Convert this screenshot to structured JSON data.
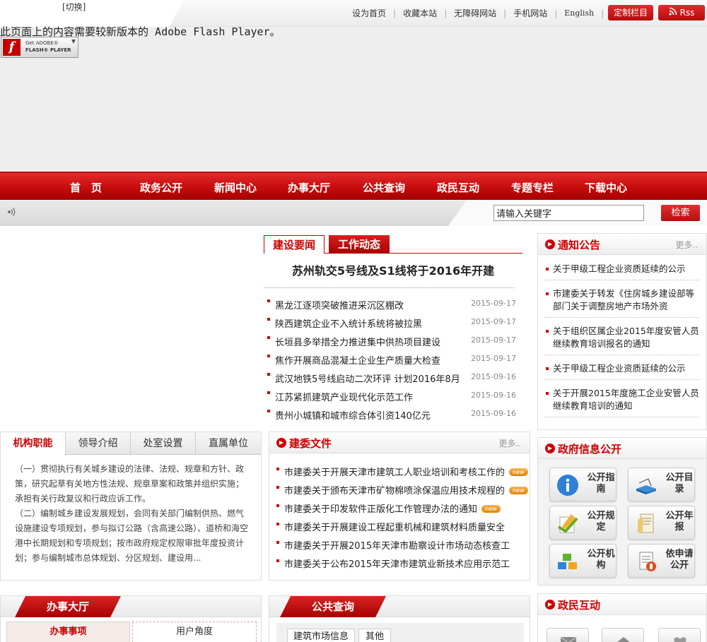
{
  "topbar": {
    "switch_label": "[切换]",
    "links": [
      "设为首页",
      "收藏本站",
      "无障碍网站",
      "手机网站",
      "English"
    ],
    "customize_label": "定制栏目",
    "rss_label": "Rss"
  },
  "flash": {
    "message": "此页面上的内容需要较新版本的 Adobe Flash Player。",
    "badge_line1": "Get ADOBE®",
    "badge_line2": "FLASH® PLAYER"
  },
  "nav": {
    "items": [
      "首　页",
      "政务公开",
      "新闻中心",
      "办事大厅",
      "公共查询",
      "政民互动",
      "专题专栏",
      "下载中心"
    ]
  },
  "search": {
    "value": "请输入关键字",
    "button_label": "检索"
  },
  "news": {
    "tabs": [
      "建设要闻",
      "工作动态"
    ],
    "headline": "苏州轨交5号线及S1线将于2016年开建",
    "items": [
      {
        "title": "黑龙江逐项突破推进采沉区棚改",
        "date": "2015-09-17"
      },
      {
        "title": "陕西建筑企业不入统计系统将被拉黑",
        "date": "2015-09-17"
      },
      {
        "title": "长垣县多举措全力推进集中供热项目建设",
        "date": "2015-09-17"
      },
      {
        "title": "焦作开展商品混凝土企业生产质量大检查",
        "date": "2015-09-17"
      },
      {
        "title": "武汉地铁5号线启动二次环评  计划2016年8月",
        "date": "2015-09-16"
      },
      {
        "title": "江苏紧抓建筑产业现代化示范工作",
        "date": "2015-09-16"
      },
      {
        "title": "贵州小城镇和城市综合体引资140亿元",
        "date": "2015-09-16"
      }
    ]
  },
  "notice": {
    "title": "通知公告",
    "more": "更多..",
    "items": [
      "关于甲级工程企业资质延续的公示",
      "市建委关于转发《住房城乡建设部等部门关于调整房地产市场外资",
      "关于组织区属企业2015年度安管人员继续教育培训报名的通知",
      "关于甲级工程企业资质延续的公示",
      "关于开展2015年度施工企业安管人员继续教育培训的通知"
    ]
  },
  "agency": {
    "tabs": [
      "机构职能",
      "领导介绍",
      "处室设置",
      "直属单位"
    ],
    "paragraphs": [
      "（一）贯彻执行有关城乡建设的法律、法规、规章和方针、政策，研究起草有关地方性法规、规章草案和政策并组织实施；承担有关行政复议和行政应诉工作。",
      "（二）编制城乡建设发展规划，会同有关部门编制供热、燃气设施建设专项规划，参与拟订公路（含高速公路）、道桥和海空港中长期规划和专项规划；按市政府规定权限审批年度投资计划；参与编制城市总体规划、分区规划、建设用..."
    ]
  },
  "docs": {
    "title": "建委文件",
    "more": "更多..",
    "new_label": "new",
    "items": [
      {
        "title": "市建委关于开展天津市建筑工人职业培训和考核工作的",
        "is_new": true
      },
      {
        "title": "市建委关于颁布天津市矿物棉喷涂保温应用技术规程的",
        "is_new": true
      },
      {
        "title": "市建委关于印发软件正版化工作管理办法的通知",
        "is_new": true
      },
      {
        "title": "市建委关于开展建设工程起重机械和建筑材料质量安全",
        "is_new": false
      },
      {
        "title": "市建委关于开展2015年天津市勘察设计市场动态核查工",
        "is_new": false
      },
      {
        "title": "市建委关于公布2015年天津市建筑业新技术应用示范工",
        "is_new": false
      }
    ]
  },
  "govinfo": {
    "title": "政府信息公开",
    "buttons": [
      {
        "label": "公开指南",
        "icon": "info-icon"
      },
      {
        "label": "公开目录",
        "icon": "book-icon"
      },
      {
        "label": "公开规定",
        "icon": "pencil-doc-icon"
      },
      {
        "label": "公开年报",
        "icon": "report-icon"
      },
      {
        "label": "公开机构",
        "icon": "blocks-icon"
      },
      {
        "label": "依申请公开",
        "icon": "application-icon"
      }
    ]
  },
  "hall": {
    "title": "办事大厅",
    "tabs": [
      "办事事项",
      "用户角度"
    ]
  },
  "query": {
    "title": "公共查询",
    "tabs": [
      "建筑市场信息",
      "其他"
    ]
  },
  "interact": {
    "title": "政民互动"
  },
  "colors": {
    "brand_red": "#c00000",
    "nav_red": "#c80e0e",
    "new_badge": "#f0a030"
  }
}
